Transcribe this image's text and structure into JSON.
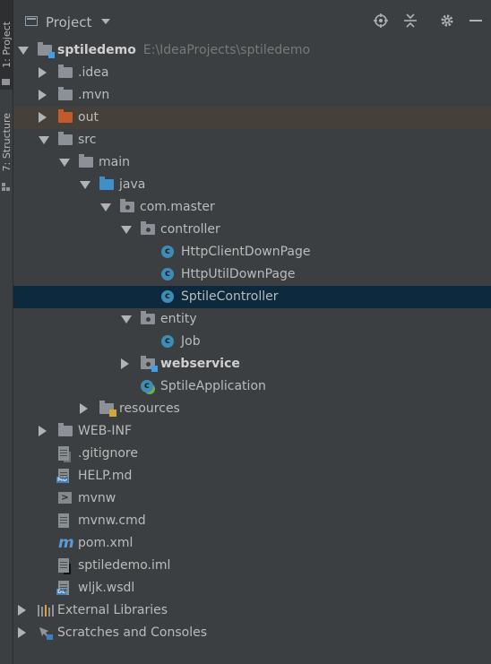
{
  "side_tabs": [
    "1: Project",
    "7: Structure"
  ],
  "header": {
    "title": "Project"
  },
  "tree": [
    {
      "id": "root",
      "label": "sptiledemo",
      "path": "E:\\IdeaProjects\\sptiledemo",
      "level": 0,
      "arrow": "down",
      "icon": "module-folder",
      "bold": true
    },
    {
      "id": "idea",
      "label": ".idea",
      "level": 1,
      "arrow": "right",
      "icon": "folder"
    },
    {
      "id": "mvn",
      "label": ".mvn",
      "level": 1,
      "arrow": "right",
      "icon": "folder"
    },
    {
      "id": "out",
      "label": "out",
      "level": 1,
      "arrow": "right",
      "icon": "folder-orange",
      "highlight": true
    },
    {
      "id": "src",
      "label": "src",
      "level": 1,
      "arrow": "down",
      "icon": "folder"
    },
    {
      "id": "main",
      "label": "main",
      "level": 2,
      "arrow": "down",
      "icon": "folder"
    },
    {
      "id": "java",
      "label": "java",
      "level": 3,
      "arrow": "down",
      "icon": "folder-blue"
    },
    {
      "id": "com-master",
      "label": "com.master",
      "level": 4,
      "arrow": "down",
      "icon": "package"
    },
    {
      "id": "controller",
      "label": "controller",
      "level": 5,
      "arrow": "down",
      "icon": "package"
    },
    {
      "id": "httpclientdownpage",
      "label": "HttpClientDownPage",
      "level": 6,
      "arrow": "none",
      "icon": "class"
    },
    {
      "id": "httputildownpage",
      "label": "HttpUtilDownPage",
      "level": 6,
      "arrow": "none",
      "icon": "class"
    },
    {
      "id": "sptilecontroller",
      "label": "SptileController",
      "level": 6,
      "arrow": "none",
      "icon": "class",
      "selected": true
    },
    {
      "id": "entity",
      "label": "entity",
      "level": 5,
      "arrow": "down",
      "icon": "package"
    },
    {
      "id": "job",
      "label": "Job",
      "level": 6,
      "arrow": "none",
      "icon": "class"
    },
    {
      "id": "webservice",
      "label": "webservice",
      "level": 5,
      "arrow": "right",
      "icon": "package-blue",
      "bold": true
    },
    {
      "id": "sptileapplication",
      "label": "SptileApplication",
      "level": 5,
      "arrow": "none",
      "icon": "spring-class"
    },
    {
      "id": "resources",
      "label": "resources",
      "level": 3,
      "arrow": "right",
      "icon": "resources-folder"
    },
    {
      "id": "web-inf",
      "label": "WEB-INF",
      "level": 1,
      "arrow": "right",
      "icon": "folder"
    },
    {
      "id": "gitignore",
      "label": ".gitignore",
      "level": 1,
      "arrow": "none",
      "icon": "file-ignore"
    },
    {
      "id": "help-md",
      "label": "HELP.md",
      "level": 1,
      "arrow": "none",
      "icon": "file-md"
    },
    {
      "id": "mvnw",
      "label": "mvnw",
      "level": 1,
      "arrow": "none",
      "icon": "file-shell"
    },
    {
      "id": "mvnw-cmd",
      "label": "mvnw.cmd",
      "level": 1,
      "arrow": "none",
      "icon": "file-text"
    },
    {
      "id": "pom-xml",
      "label": "pom.xml",
      "level": 1,
      "arrow": "none",
      "icon": "maven"
    },
    {
      "id": "sptiledemo-iml",
      "label": "sptiledemo.iml",
      "level": 1,
      "arrow": "none",
      "icon": "file-iml"
    },
    {
      "id": "wljk-wsdl",
      "label": "wljk.wsdl",
      "level": 1,
      "arrow": "none",
      "icon": "file-dl"
    },
    {
      "id": "external-libraries",
      "label": "External Libraries",
      "level": 0,
      "arrow": "right",
      "icon": "libraries"
    },
    {
      "id": "scratches",
      "label": "Scratches and Consoles",
      "level": 0,
      "arrow": "right",
      "icon": "scratches"
    }
  ],
  "colors": {
    "background": "#3c3f41",
    "selected": "#0d293e",
    "highlight": "#45413a",
    "text": "#bbbbbb",
    "path": "#787878",
    "class_icon": "#3d8db8",
    "folder_blue": "#3f8fc9",
    "folder_orange": "#c35a2a"
  }
}
